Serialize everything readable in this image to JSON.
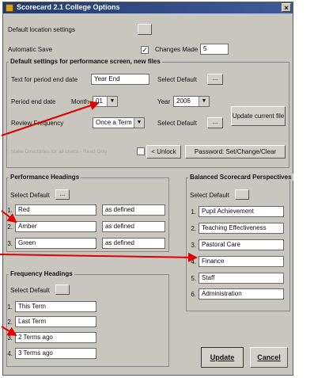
{
  "window": {
    "title": "Scorecard 2.1 College Options",
    "close": "×"
  },
  "top": {
    "default_location_label": "Default location settings",
    "automatic_save_label": "Automatic Save",
    "changes_made_label": "Changes Made",
    "changes_made_value": "5"
  },
  "defaults": {
    "group_title": "Default settings for performance screen, new files",
    "text_period_label": "Text for period end date",
    "text_period_value": "Year End",
    "select_default": "Select Default",
    "ellipsis": "...",
    "period_end_label": "Period end date",
    "month_label": "Month",
    "month_value": "01",
    "year_label": "Year",
    "year_value": "2006",
    "review_label": "Review Frequency",
    "review_value": "Once a Term",
    "update_file": "Update current file",
    "make_dirs": "Make Directories for all Users - Read Only",
    "unlock": "< Unlock",
    "password": "Password: Set/Change/Clear"
  },
  "performance": {
    "title": "Performance Headings",
    "select_default": "Select Default",
    "rows": [
      {
        "num": "1.",
        "name": "Red",
        "desc": "as defined"
      },
      {
        "num": "2.",
        "name": "Amber",
        "desc": "as defined"
      },
      {
        "num": "3.",
        "name": "Green",
        "desc": "as defined"
      }
    ]
  },
  "frequency": {
    "title": "Frequency Headings",
    "select_default": "Select Default",
    "rows": [
      {
        "num": "1.",
        "name": "This Term"
      },
      {
        "num": "2.",
        "name": "Last Term"
      },
      {
        "num": "3.",
        "name": "2 Terms ago"
      },
      {
        "num": "4.",
        "name": "3 Terms ago"
      }
    ]
  },
  "perspectives": {
    "title": "Balanced Scorecard Perspectives",
    "select_default": "Select Default",
    "rows": [
      {
        "num": "1.",
        "name": "Pupil Achievement"
      },
      {
        "num": "2.",
        "name": "Teaching Effectiveness"
      },
      {
        "num": "3.",
        "name": "Pastoral Care"
      },
      {
        "num": "4.",
        "name": "Finance"
      },
      {
        "num": "5.",
        "name": "Staff"
      },
      {
        "num": "6.",
        "name": "Administration"
      }
    ]
  },
  "actions": {
    "update": "Update",
    "cancel": "Cancel"
  },
  "colors": {
    "arrow": "#e00000",
    "titlebar": "#2f4a84",
    "dialog_bg": "#c9c6bf"
  }
}
